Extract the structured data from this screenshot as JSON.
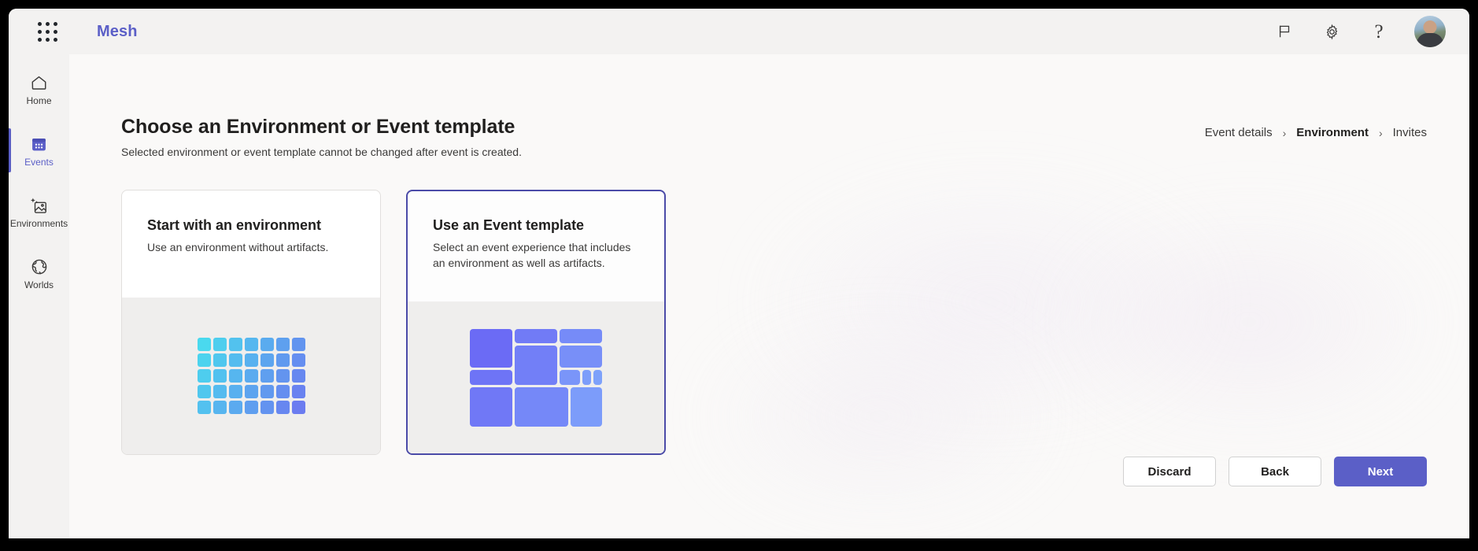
{
  "topbar": {
    "waffle_icon": "app-launcher-icon",
    "app_title": "Mesh",
    "actions": [
      {
        "icon": "flag-icon",
        "label": "Feedback"
      },
      {
        "icon": "gear-icon",
        "label": "Settings"
      },
      {
        "icon": "help-icon",
        "label": "?"
      }
    ],
    "avatar_label": "Account manager"
  },
  "sidebar": {
    "items": [
      {
        "label": "Home",
        "icon": "home-icon",
        "active": false
      },
      {
        "label": "Events",
        "icon": "calendar-icon",
        "active": true
      },
      {
        "label": "Environments",
        "icon": "image-sparkle-icon",
        "active": false
      },
      {
        "label": "Worlds",
        "icon": "globe-icon",
        "active": false
      }
    ]
  },
  "page": {
    "title": "Choose an Environment or Event template",
    "subtitle": "Selected environment or event template cannot be changed after event is created."
  },
  "breadcrumb": {
    "separator": "›",
    "items": [
      {
        "label": "Event details",
        "current": false
      },
      {
        "label": "Environment",
        "current": true
      },
      {
        "label": "Invites",
        "current": false
      }
    ]
  },
  "cards": [
    {
      "title": "Start with an environment",
      "description": "Use an environment without artifacts.",
      "selected": false,
      "art": "grid-art"
    },
    {
      "title": "Use an Event template",
      "description": "Select an event experience that includes an environment as well as artifacts.",
      "selected": true,
      "art": "mosaic-art"
    }
  ],
  "footer": {
    "discard_label": "Discard",
    "back_label": "Back",
    "next_label": "Next"
  },
  "colors": {
    "brand_purple": "#5b5fc7",
    "selected_border": "#4b4ba8",
    "topbar_bg": "#f3f2f1",
    "content_bg": "#faf9f8",
    "art_bg": "#efeeed",
    "grid_from": "#4ad9ee",
    "grid_to": "#6b7cf0",
    "mosaic_from": "#6b6bf5",
    "mosaic_to": "#82acfb"
  }
}
